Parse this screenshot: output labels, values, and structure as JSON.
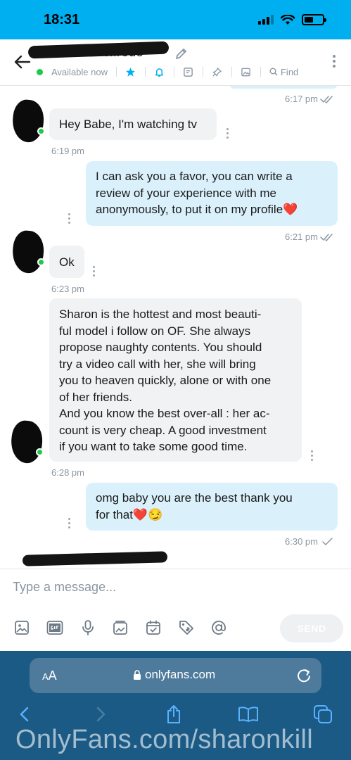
{
  "status_bar": {
    "time": "18:31",
    "battery_level": 0.5
  },
  "header": {
    "username": "ricric14 ricisifredo",
    "availability": "Available now",
    "find_label": "Find"
  },
  "messages": [
    {
      "side": "in",
      "text": "Hey Babe, I'm watching tv",
      "time": "6:19 pm"
    },
    {
      "side": "out",
      "lines": [
        "I can ask you a favor, you can write a",
        "review of your experience with me",
        "anonymously, to put it on my profile❤️"
      ],
      "time": "6:21 pm",
      "status": "read"
    },
    {
      "side": "in",
      "text": "Ok",
      "time": "6:23 pm"
    },
    {
      "side": "in",
      "lines": [
        "Sharon is the hottest and most beauti-",
        "ful model i follow on OF. She always",
        "propose naughty contents. You should",
        "try a video call with her, she will bring",
        "you to heaven quickly, alone or with one",
        "of her friends.",
        "And you know the best over-all : her ac-",
        "count is very cheap. A good investment",
        "if you want to take some good time."
      ],
      "time": "6:28 pm"
    },
    {
      "side": "out",
      "lines": [
        "omg baby you are the best thank you",
        "for that❤️😏"
      ],
      "time": "6:30 pm",
      "status": "sent"
    }
  ],
  "previous_message_time": "6:17 pm",
  "composer": {
    "placeholder": "Type a message...",
    "send_label": "SEND"
  },
  "browser": {
    "text_size_label_small": "A",
    "text_size_label_large": "A",
    "url": "onlyfans.com"
  },
  "watermark": "OnlyFans.com/sharonkill",
  "colors": {
    "brand": "#00aff0",
    "online": "#1fc84a",
    "outgoing_bubble": "#daf1fc",
    "incoming_bubble": "#f0f2f4"
  }
}
